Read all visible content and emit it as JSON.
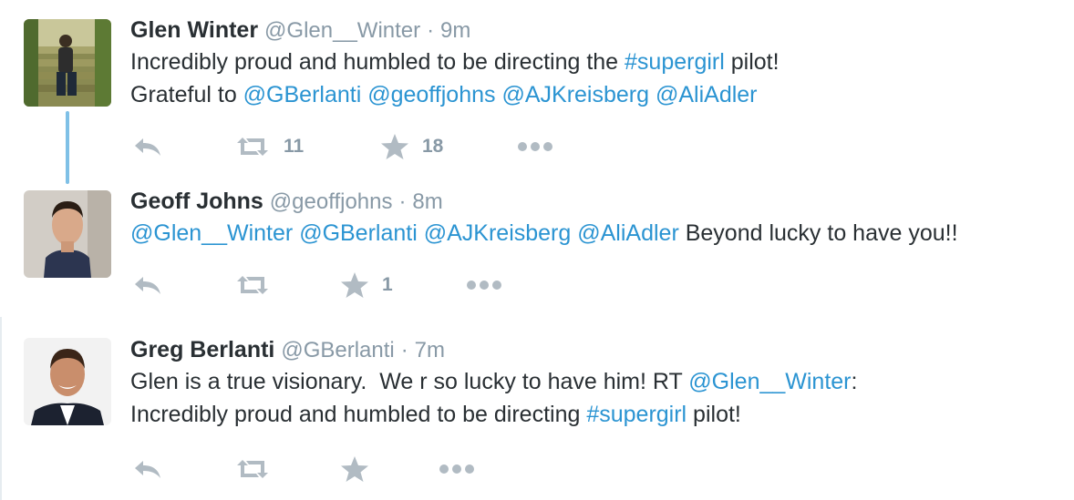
{
  "colors": {
    "link": "#2b94d2",
    "muted": "#8899a6",
    "icon": "#b1bbc3",
    "thread": "#7fc0e6",
    "text": "#292f33"
  },
  "tweets": [
    {
      "name": "Glen Winter",
      "handle": "@Glen__Winter",
      "dot": "·",
      "time": "9m",
      "lines": [
        [
          {
            "t": "Incredibly proud and humbled to be directing the ",
            "link": false
          },
          {
            "t": "#supergirl",
            "link": true
          },
          {
            "t": " pilot!",
            "link": false
          }
        ],
        [
          {
            "t": "Grateful to ",
            "link": false
          },
          {
            "t": "@GBerlanti",
            "link": true
          },
          {
            "t": " ",
            "link": false
          },
          {
            "t": "@geoffjohns",
            "link": true
          },
          {
            "t": " ",
            "link": false
          },
          {
            "t": "@AJKreisberg",
            "link": true
          },
          {
            "t": " ",
            "link": false
          },
          {
            "t": "@AliAdler",
            "link": true
          }
        ]
      ],
      "icons": {
        "reply": "reply-icon",
        "retweet": "retweet-icon",
        "favorite": "star-icon",
        "more": "more-dots-icon"
      },
      "retweet_count": "11",
      "favorite_count": "18"
    },
    {
      "name": "Geoff Johns",
      "handle": "@geoffjohns",
      "dot": "·",
      "time": "8m",
      "lines": [
        [
          {
            "t": "@Glen__Winter",
            "link": true
          },
          {
            "t": " ",
            "link": false
          },
          {
            "t": "@GBerlanti",
            "link": true
          },
          {
            "t": " ",
            "link": false
          },
          {
            "t": "@AJKreisberg",
            "link": true
          },
          {
            "t": " ",
            "link": false
          },
          {
            "t": "@AliAdler",
            "link": true
          },
          {
            "t": " Beyond lucky to have you!!",
            "link": false
          }
        ]
      ],
      "icons": {
        "reply": "reply-icon",
        "retweet": "retweet-icon",
        "favorite": "star-icon",
        "more": "more-dots-icon"
      },
      "retweet_count": "",
      "favorite_count": "1"
    },
    {
      "name": "Greg Berlanti",
      "handle": "@GBerlanti",
      "dot": "·",
      "time": "7m",
      "lines": [
        [
          {
            "t": "Glen is a true visionary.  We r so lucky to have him! RT ",
            "link": false
          },
          {
            "t": "@Glen__Winter",
            "link": true
          },
          {
            "t": ":",
            "link": false
          }
        ],
        [
          {
            "t": "Incredibly proud and humbled to be directing ",
            "link": false
          },
          {
            "t": "#supergirl",
            "link": true
          },
          {
            "t": " pilot!",
            "link": false
          }
        ]
      ],
      "icons": {
        "reply": "reply-icon",
        "retweet": "retweet-icon",
        "favorite": "star-icon",
        "more": "more-dots-icon"
      },
      "retweet_count": "",
      "favorite_count": ""
    }
  ]
}
